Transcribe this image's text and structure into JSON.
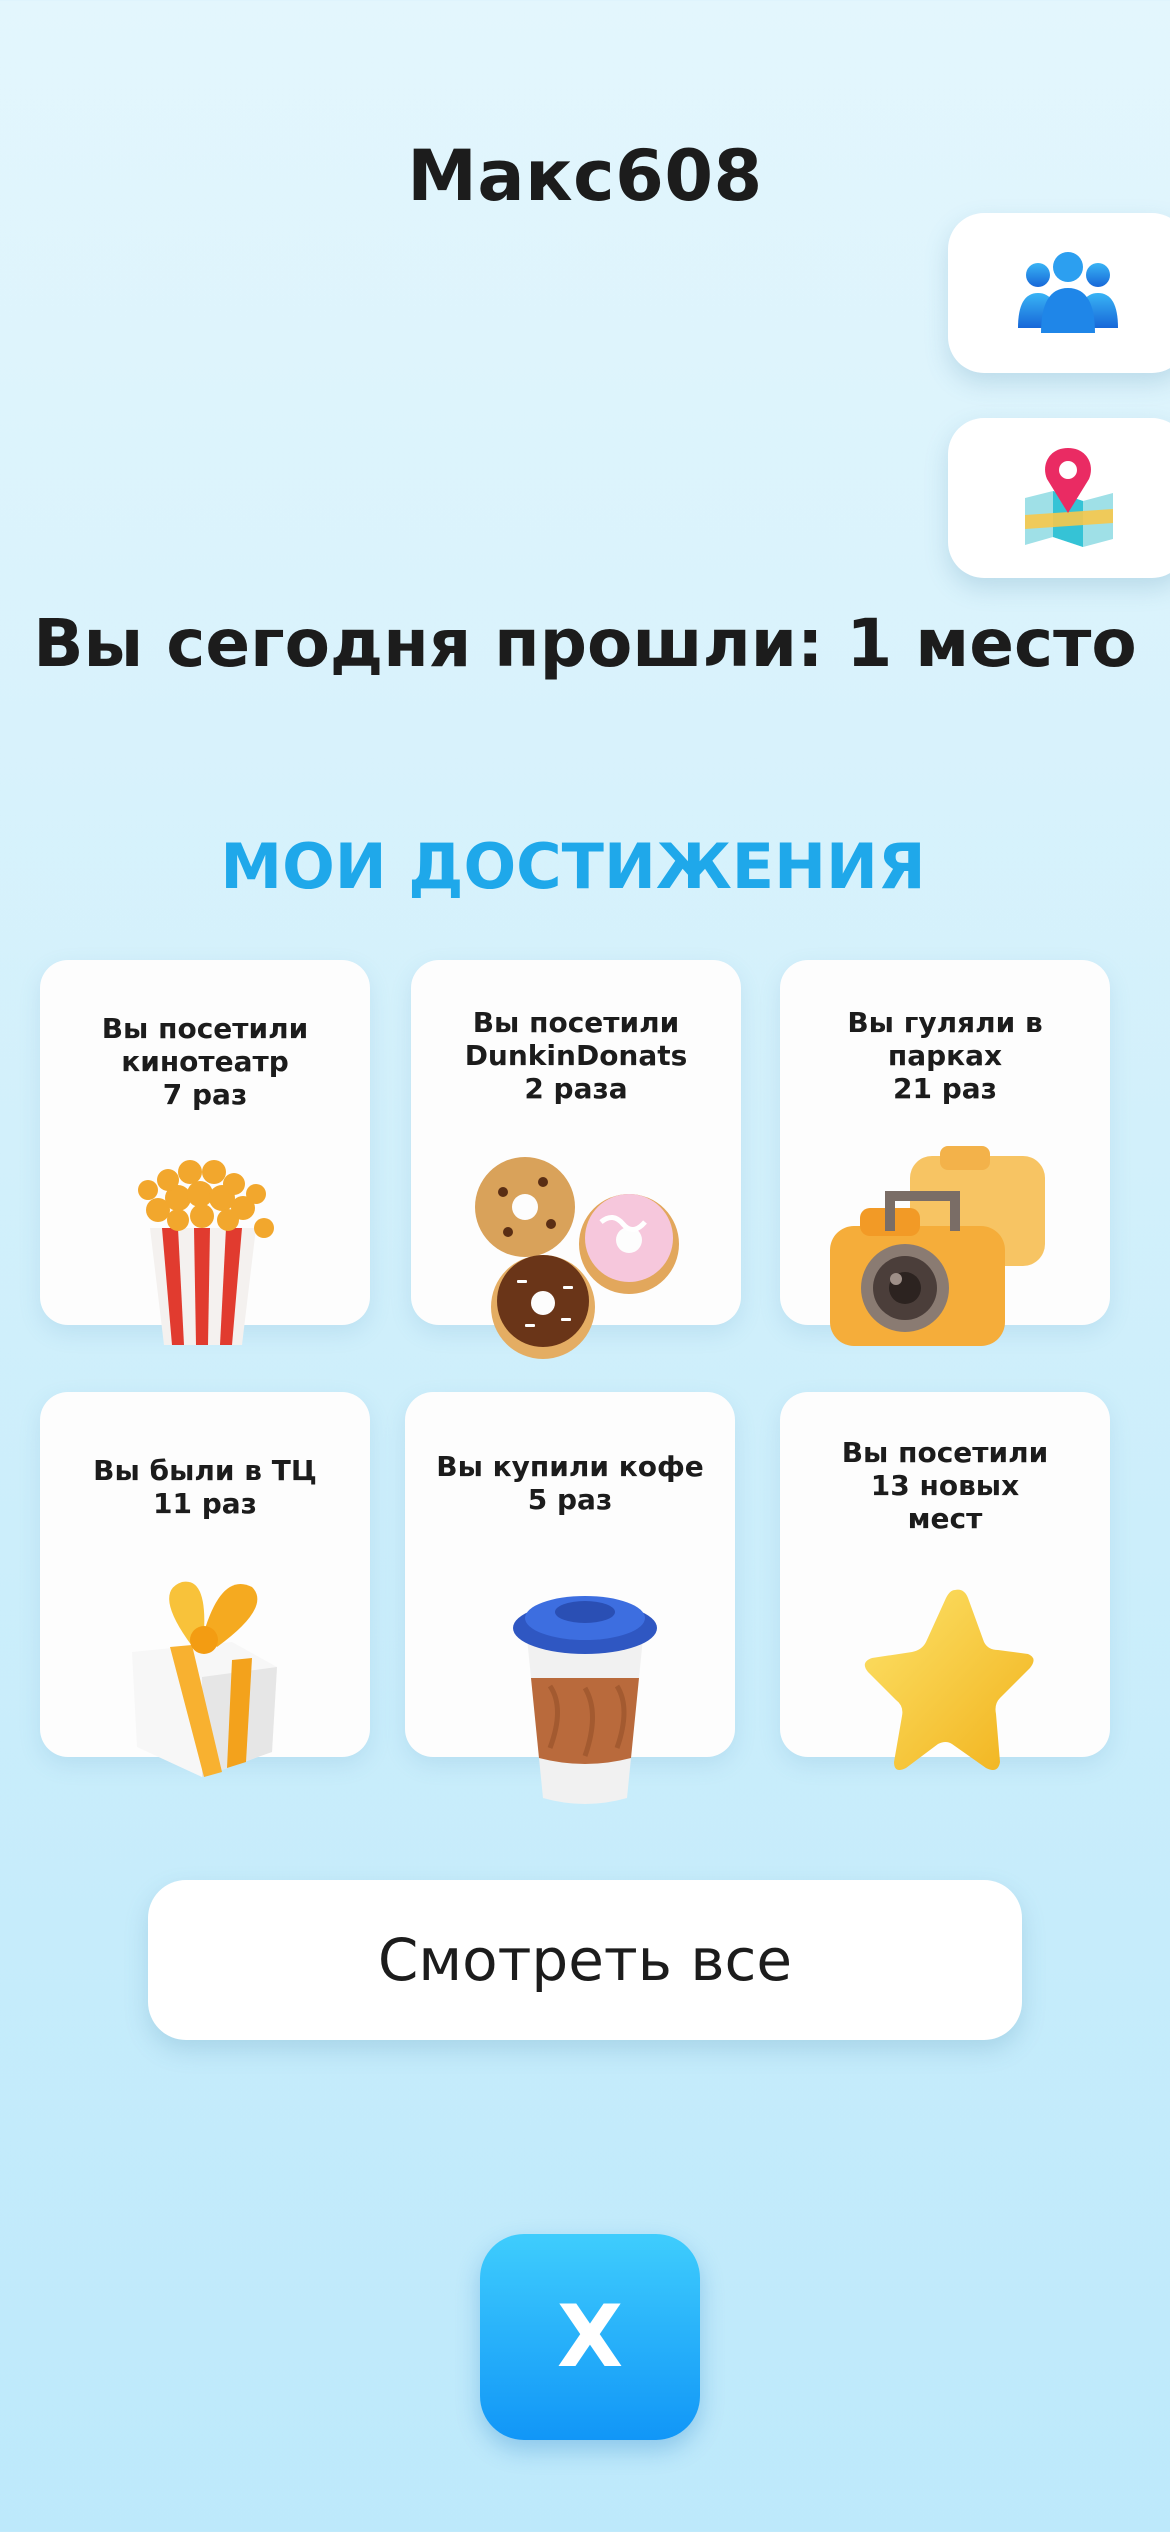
{
  "header": {
    "username": "Макс608"
  },
  "side_buttons": {
    "friends_icon": "people-group-icon",
    "map_icon": "map-pin-icon"
  },
  "today": {
    "text": "Вы сегодня прошли: 1 место"
  },
  "achievements": {
    "title": "МОИ ДОСТИЖЕНИЯ",
    "items": [
      {
        "text": "Вы посетили\nкинотеатр\n7 раз",
        "icon": "popcorn-icon"
      },
      {
        "text": "Вы посетили\nDunkinDonats\n2 раза",
        "icon": "donuts-icon"
      },
      {
        "text": "Вы гуляли в\nпарках\n21 раз",
        "icon": "camera-icon"
      },
      {
        "text": "Вы были в ТЦ\n11 раз",
        "icon": "gift-box-icon"
      },
      {
        "text": "Вы купили кофе\n5 раз",
        "icon": "coffee-cup-icon"
      },
      {
        "text": "Вы посетили\n13 новых\nмест",
        "icon": "star-icon"
      }
    ]
  },
  "see_all": {
    "label": "Смотреть все"
  },
  "close": {
    "label": "X"
  }
}
